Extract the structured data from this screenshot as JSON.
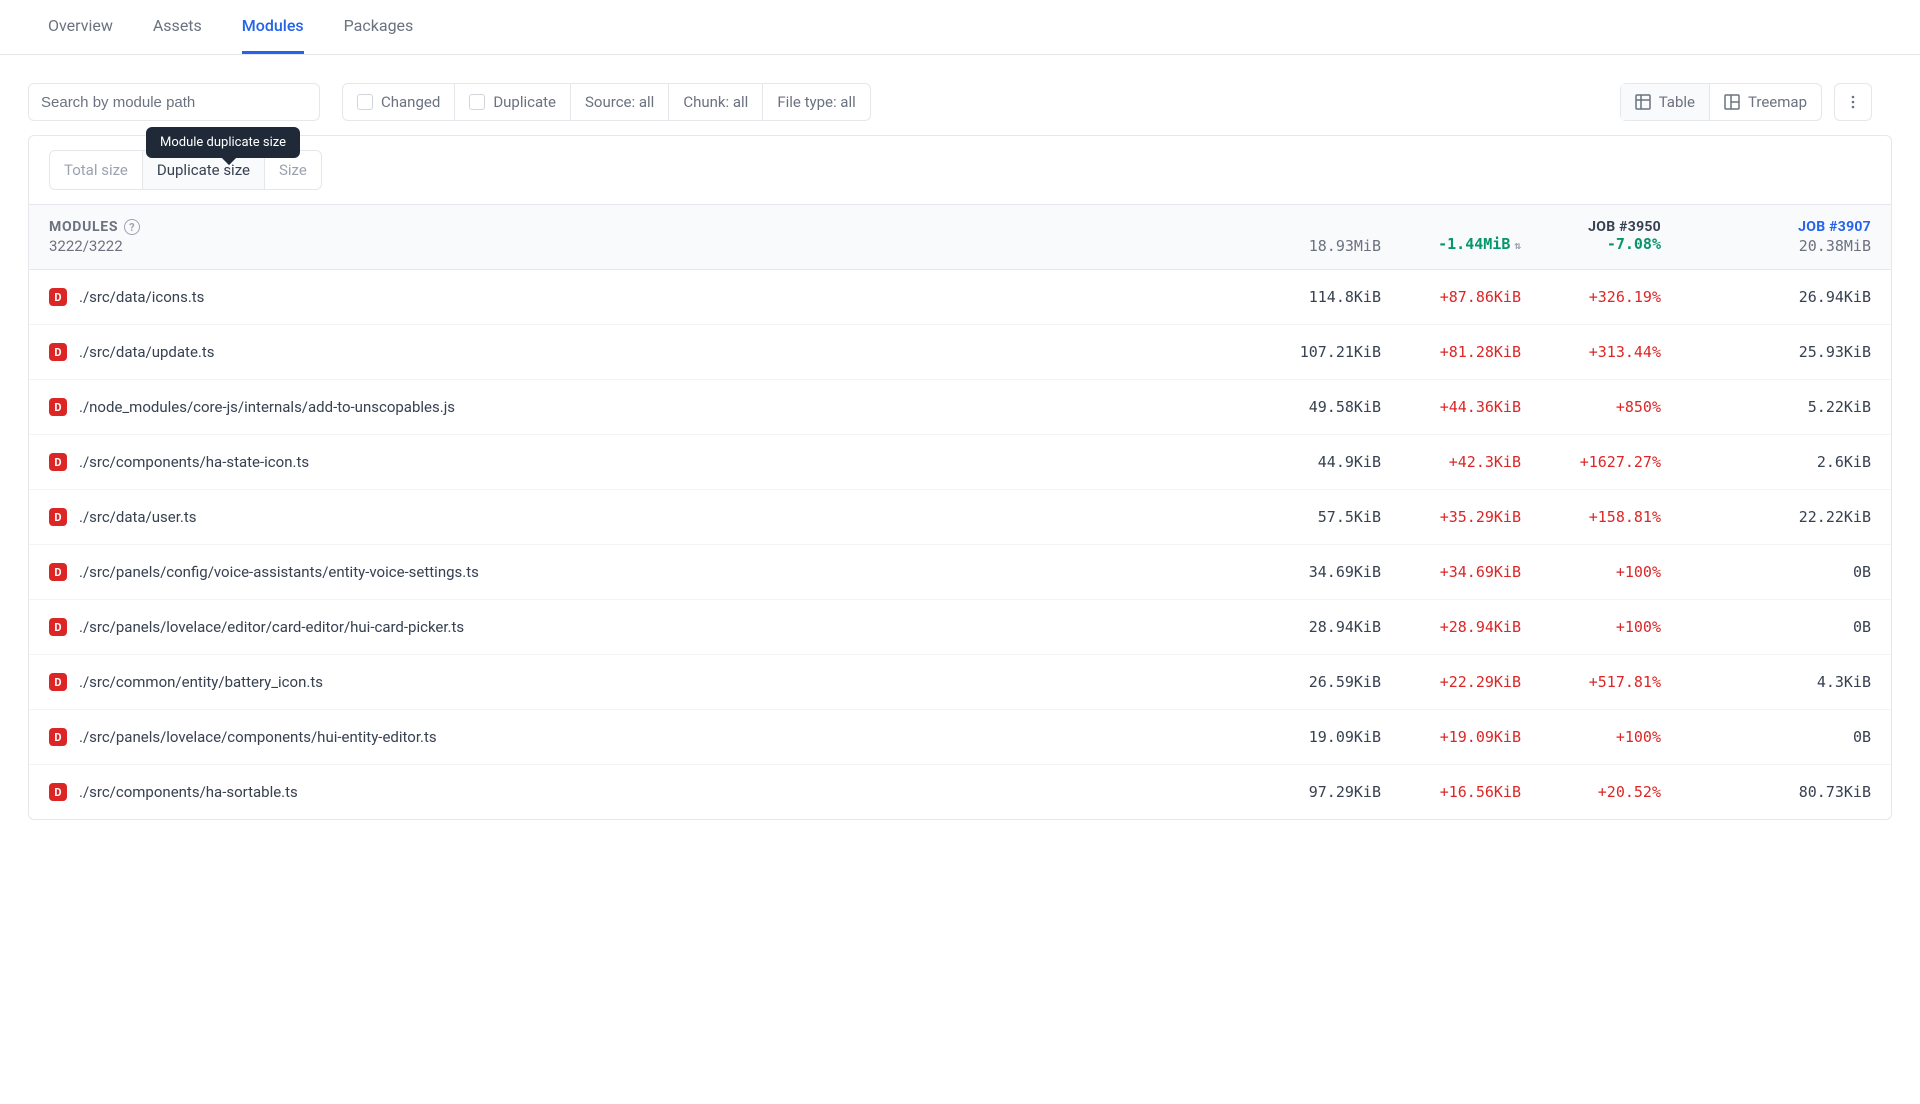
{
  "tabs": {
    "overview": "Overview",
    "assets": "Assets",
    "modules": "Modules",
    "packages": "Packages"
  },
  "search": {
    "placeholder": "Search by module path"
  },
  "filters": {
    "changed": "Changed",
    "duplicate": "Duplicate",
    "source": "Source: all",
    "chunk": "Chunk: all",
    "filetype": "File type: all"
  },
  "views": {
    "table": "Table",
    "treemap": "Treemap"
  },
  "tooltip": "Module duplicate size",
  "sizeTabs": {
    "total": "Total size",
    "duplicate": "Duplicate size",
    "size": "Size"
  },
  "header": {
    "title": "MODULES",
    "count": "3222/3222",
    "jobA": "JOB #3950",
    "jobB": "JOB #3907",
    "totalA": "18.93MiB",
    "delta": "-1.44MiB",
    "deltaPct": "-7.08%",
    "totalB": "20.38MiB"
  },
  "rows": [
    {
      "badge": "D",
      "path": "./src/data/icons.ts",
      "a": "114.8KiB",
      "d": "+87.86KiB",
      "p": "+326.19%",
      "b": "26.94KiB"
    },
    {
      "badge": "D",
      "path": "./src/data/update.ts",
      "a": "107.21KiB",
      "d": "+81.28KiB",
      "p": "+313.44%",
      "b": "25.93KiB"
    },
    {
      "badge": "D",
      "path": "./node_modules/core-js/internals/add-to-unscopables.js",
      "a": "49.58KiB",
      "d": "+44.36KiB",
      "p": "+850%",
      "b": "5.22KiB"
    },
    {
      "badge": "D",
      "path": "./src/components/ha-state-icon.ts",
      "a": "44.9KiB",
      "d": "+42.3KiB",
      "p": "+1627.27%",
      "b": "2.6KiB"
    },
    {
      "badge": "D",
      "path": "./src/data/user.ts",
      "a": "57.5KiB",
      "d": "+35.29KiB",
      "p": "+158.81%",
      "b": "22.22KiB"
    },
    {
      "badge": "D",
      "path": "./src/panels/config/voice-assistants/entity-voice-settings.ts",
      "a": "34.69KiB",
      "d": "+34.69KiB",
      "p": "+100%",
      "b": "0B"
    },
    {
      "badge": "D",
      "path": "./src/panels/lovelace/editor/card-editor/hui-card-picker.ts",
      "a": "28.94KiB",
      "d": "+28.94KiB",
      "p": "+100%",
      "b": "0B"
    },
    {
      "badge": "D",
      "path": "./src/common/entity/battery_icon.ts",
      "a": "26.59KiB",
      "d": "+22.29KiB",
      "p": "+517.81%",
      "b": "4.3KiB"
    },
    {
      "badge": "D",
      "path": "./src/panels/lovelace/components/hui-entity-editor.ts",
      "a": "19.09KiB",
      "d": "+19.09KiB",
      "p": "+100%",
      "b": "0B"
    },
    {
      "badge": "D",
      "path": "./src/components/ha-sortable.ts",
      "a": "97.29KiB",
      "d": "+16.56KiB",
      "p": "+20.52%",
      "b": "80.73KiB"
    }
  ]
}
